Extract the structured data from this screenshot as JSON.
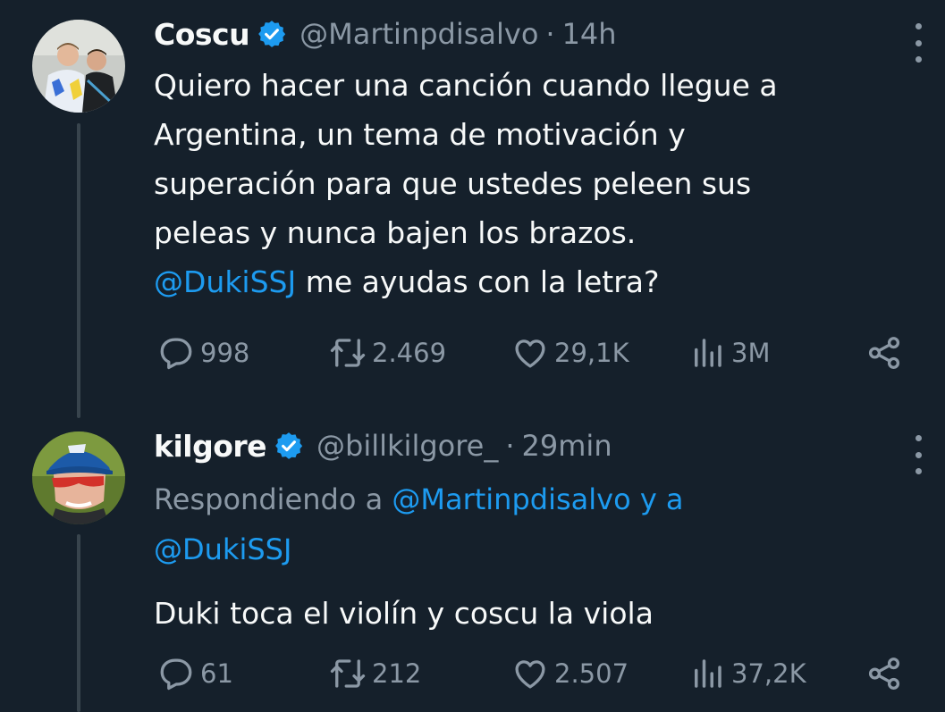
{
  "tweets": [
    {
      "name": "Coscu",
      "handle": "@Martinpdisalvo",
      "separator": "·",
      "time": "14h",
      "text_main": "Quiero hacer una canción cuando llegue a\nArgentina, un tema de motivación y\nsuperación para que ustedes peleen sus\npeleas y nunca bajen los brazos.\n",
      "text_mention": "@DukiSSJ",
      "text_tail": " me ayudas con la letra?",
      "replies": "998",
      "retweets": "2.469",
      "likes": "29,1K",
      "views": "3M"
    },
    {
      "name": "kilgore",
      "handle": "@billkilgore_",
      "separator": "·",
      "time": "29min",
      "reply_prefix": "Respondiendo a ",
      "reply_mention_1": "@Martinpdisalvo",
      "reply_conj": " y a",
      "reply_mention_2": "@DukiSSJ",
      "text": "Duki toca el violín y coscu la viola",
      "replies": "61",
      "retweets": "212",
      "likes": "2.507",
      "views": "37,2K"
    }
  ],
  "colors": {
    "background": "#15202b",
    "text": "#f7f9f9",
    "secondary": "#8b98a5",
    "accent": "#1d9bf0",
    "thread_line": "#38444d"
  },
  "icons": {
    "verified": "verified-badge-icon",
    "reply": "reply-icon",
    "retweet": "retweet-icon",
    "like": "heart-icon",
    "views": "views-icon",
    "share": "share-icon",
    "more": "more-options-icon"
  }
}
